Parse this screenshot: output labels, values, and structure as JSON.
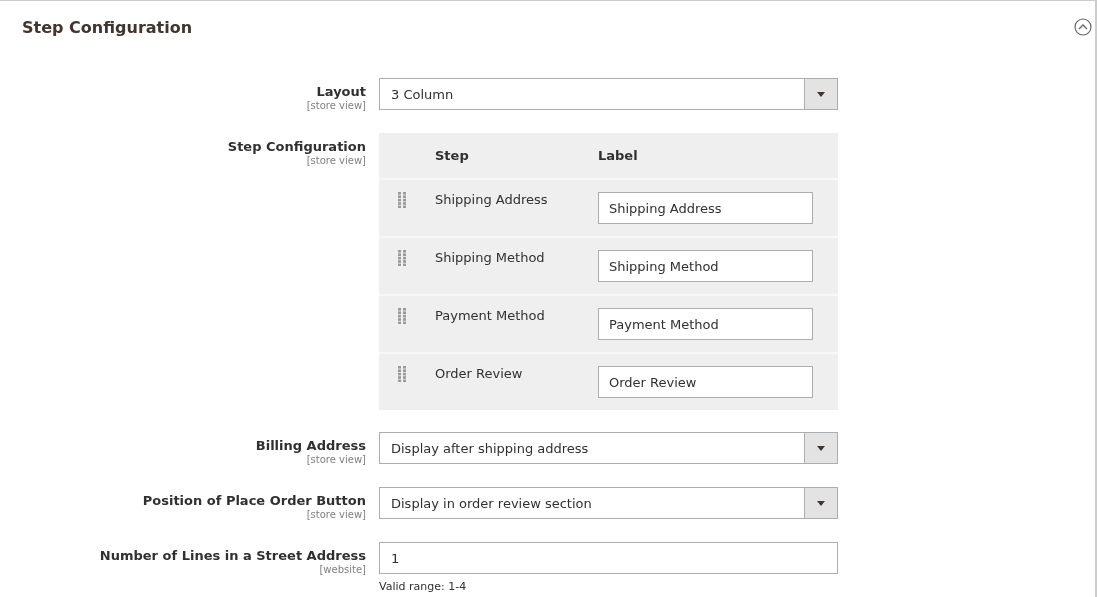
{
  "section": {
    "title": "Step Configuration",
    "expanded": true
  },
  "fields": [
    {
      "kind": "select",
      "label": "Layout",
      "scope": "[store view]",
      "value": "3 Column"
    },
    {
      "kind": "steps",
      "label": "Step Configuration",
      "scope": "[store view]",
      "columns": [
        "Step",
        "Label"
      ],
      "rows": [
        {
          "step": "Shipping Address",
          "value": "Shipping Address"
        },
        {
          "step": "Shipping Method",
          "value": "Shipping Method"
        },
        {
          "step": "Payment Method",
          "value": "Payment Method"
        },
        {
          "step": "Order Review",
          "value": "Order Review"
        }
      ]
    },
    {
      "kind": "select",
      "label": "Billing Address",
      "scope": "[store view]",
      "value": "Display after shipping address"
    },
    {
      "kind": "select",
      "label": "Position of Place Order Button",
      "scope": "[store view]",
      "value": "Display in order review section"
    },
    {
      "kind": "text",
      "label": "Number of Lines in a Street Address",
      "scope": "[website]",
      "value": "1",
      "note": "Valid range: 1-4"
    }
  ]
}
